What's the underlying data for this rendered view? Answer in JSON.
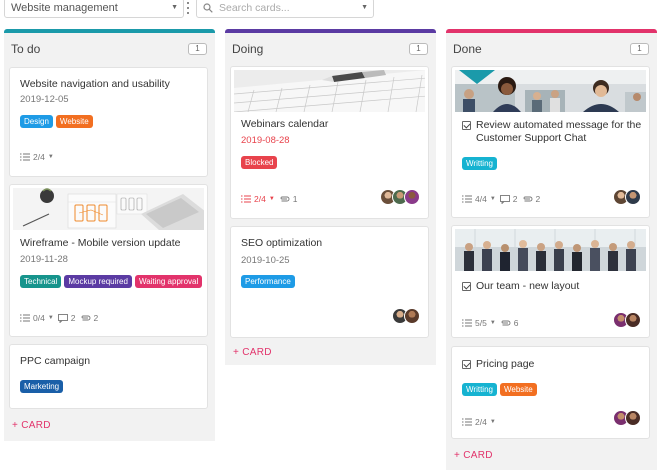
{
  "topbar": {
    "board_select_value": "Website management",
    "search_placeholder": "Search cards..."
  },
  "colors": {
    "todo_accent": "#1b9aaa",
    "doing_accent": "#5b3ba3",
    "done_accent": "#e2336b",
    "add_card": "#e2336b"
  },
  "columns": {
    "todo": {
      "title": "To do",
      "count": "1",
      "add_label": "+ CARD",
      "cards": [
        {
          "title": "Website navigation and usability",
          "date": "2019-12-05",
          "labels": [
            "Design",
            "Website"
          ],
          "checklist": "2/4"
        },
        {
          "title": "Wireframe - Mobile version update",
          "date": "2019-11-28",
          "labels": [
            "Technical",
            "Mockup required",
            "Waiting approval"
          ],
          "checklist": "0/4",
          "comments": "2",
          "attachments": "2"
        },
        {
          "title": "PPC campaign",
          "labels": [
            "Marketing"
          ]
        }
      ]
    },
    "doing": {
      "title": "Doing",
      "count": "1",
      "add_label": "+ CARD",
      "cards": [
        {
          "title": "Webinars calendar",
          "date": "2019-08-28",
          "labels": [
            "Blocked"
          ],
          "checklist": "2/4",
          "attachments": "1"
        },
        {
          "title": "SEO optimization",
          "date": "2019-10-25",
          "labels": [
            "Performance"
          ]
        }
      ]
    },
    "done": {
      "title": "Done",
      "count": "1",
      "add_label": "+ CARD",
      "cards": [
        {
          "title": "Review automated message for the Customer Support Chat",
          "labels": [
            "Writting"
          ],
          "checklist": "4/4",
          "comments": "2",
          "attachments": "2"
        },
        {
          "title": "Our team - new layout",
          "checklist": "5/5",
          "attachments": "6"
        },
        {
          "title": "Pricing page",
          "labels": [
            "Writting",
            "Website"
          ],
          "checklist": "2/4"
        }
      ]
    }
  },
  "label_colors": {
    "Design": "#1e9be6",
    "Website": "#f26f21",
    "Technical": "#16948c",
    "Mockup required": "#5b3ba3",
    "Waiting approval": "#e2336b",
    "Marketing": "#1a5fa8",
    "Blocked": "#e8434c",
    "Performance": "#1e9be6",
    "Writting": "#16b3d1"
  },
  "icons": [
    "chevron-down-icon",
    "kebab-icon",
    "search-icon",
    "checklist-icon",
    "comment-icon",
    "attachment-icon",
    "checkbox-icon"
  ]
}
